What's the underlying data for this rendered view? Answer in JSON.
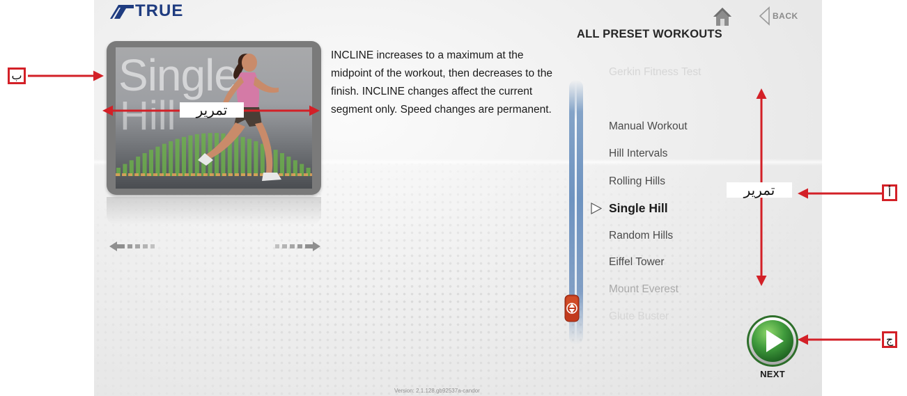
{
  "brand": {
    "name": "TRUE",
    "color": "#1f3c80"
  },
  "header": {
    "home_icon": "home-icon",
    "back_label": "BACK",
    "title": "ALL PRESET WORKOUTS"
  },
  "preview": {
    "text_line1": "Single",
    "text_line2": "Hill"
  },
  "description": "INCLINE increases to a maximum at the midpoint of the workout, then decreases to the finish.  INCLINE changes affect the current segment only.  Speed changes are permanent.",
  "workouts": [
    {
      "label": "Gerkin Fitness Test",
      "state": "faded"
    },
    {
      "label": "Manual Workout",
      "state": "normal"
    },
    {
      "label": "Hill Intervals",
      "state": "normal"
    },
    {
      "label": "Rolling Hills",
      "state": "normal"
    },
    {
      "label": "Single Hill",
      "state": "selected"
    },
    {
      "label": "Random Hills",
      "state": "normal"
    },
    {
      "label": "Eiffel Tower",
      "state": "normal"
    },
    {
      "label": "Mount Everest",
      "state": "dim"
    },
    {
      "label": "Glute Buster",
      "state": "faded"
    }
  ],
  "next": {
    "label": "NEXT",
    "color": "#3f9a3c"
  },
  "version": "Version: 2.1.128.gb92537a-candor",
  "annotations": {
    "color": "#d32027",
    "a_marker": "أ",
    "b_marker": "ب",
    "c_marker": "ج",
    "scroll_label_vertical": "تمرير",
    "scroll_label_horizontal": "تمرير"
  }
}
